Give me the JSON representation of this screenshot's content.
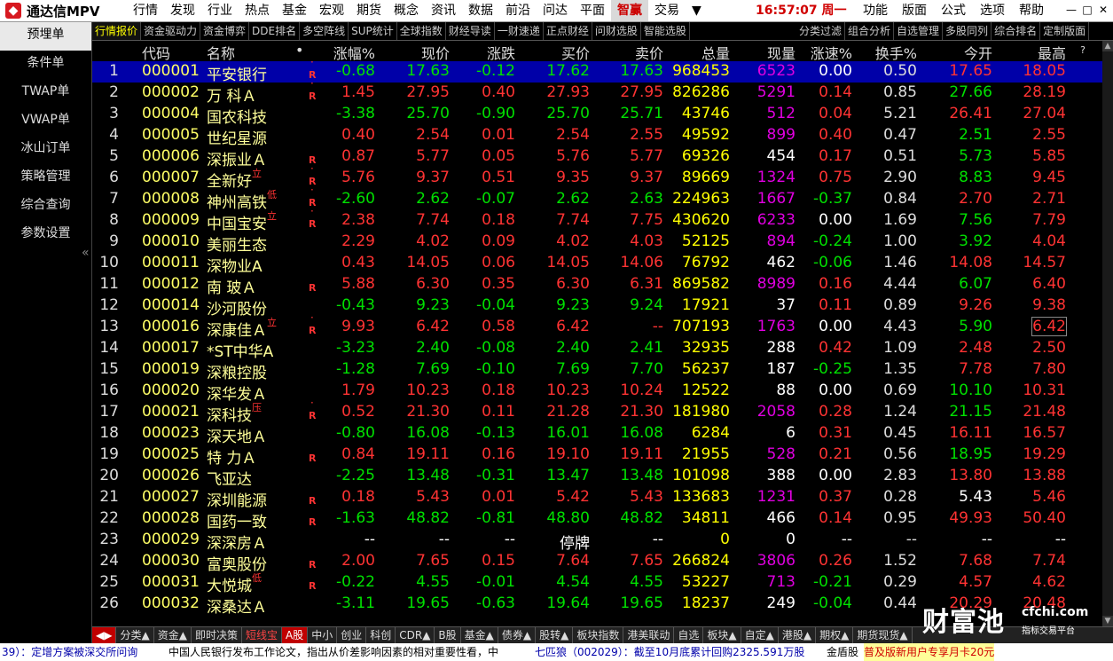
{
  "app": {
    "logo_text": "通达信MPV"
  },
  "menu": [
    "行情",
    "发现",
    "行业",
    "热点",
    "基金",
    "宏观",
    "期货",
    "概念",
    "资讯",
    "数据",
    "前沿",
    "问达",
    "平面",
    "智赢",
    "交易"
  ],
  "menu_dropdown_glyph": "▼",
  "clock": "16:57:07 周一",
  "right_menu": [
    "功能",
    "版面",
    "公式",
    "选项",
    "帮助"
  ],
  "window_controls": [
    "—",
    "□",
    "✕"
  ],
  "sidebar": {
    "items": [
      "预埋单",
      "条件单",
      "TWAP单",
      "VWAP单",
      "冰山订单",
      "策略管理",
      "综合查询",
      "参数设置"
    ],
    "collapse": "«"
  },
  "tabs": [
    "行情报价",
    "资金驱动力",
    "资金博弈",
    "DDE排名",
    "多空阵线",
    "SUP统计",
    "全球指数",
    "财经导读",
    "一财速递",
    "正点财经",
    "问财选股",
    "智能选股"
  ],
  "tabs_right": [
    "分类过滤",
    "组合分析",
    "自选管理",
    "多股同列",
    "综合排名",
    "定制版面"
  ],
  "columns": [
    "代码",
    "名称",
    "•",
    "涨幅%",
    "现价",
    "涨跌",
    "买价",
    "卖价",
    "总量",
    "现量",
    "涨速%",
    "换手%",
    "今开",
    "最高",
    "?"
  ],
  "rows": [
    {
      "idx": "1",
      "code": "000001",
      "name": "平安银行",
      "mark": "",
      "r": "R",
      "dot": "·",
      "chg": "-0.68",
      "price": "17.63",
      "diff": "-0.12",
      "bid": "17.62",
      "ask": "17.63",
      "vol": "968453",
      "cur": "6523",
      "spd": "0.00",
      "turn": "0.50",
      "open": "17.65",
      "high": "18.05"
    },
    {
      "idx": "2",
      "code": "000002",
      "name": "万 科Ａ",
      "mark": "",
      "r": "R",
      "dot": "·",
      "chg": "1.45",
      "price": "27.95",
      "diff": "0.40",
      "bid": "27.93",
      "ask": "27.95",
      "vol": "826286",
      "cur": "5291",
      "spd": "0.14",
      "turn": "0.85",
      "open": "27.66",
      "high": "28.19"
    },
    {
      "idx": "3",
      "code": "000004",
      "name": "国农科技",
      "mark": "",
      "r": "",
      "dot": "",
      "chg": "-3.38",
      "price": "25.70",
      "diff": "-0.90",
      "bid": "25.70",
      "ask": "25.71",
      "vol": "43746",
      "cur": "512",
      "spd": "0.04",
      "turn": "5.21",
      "open": "26.41",
      "high": "27.04"
    },
    {
      "idx": "4",
      "code": "000005",
      "name": "世纪星源",
      "mark": "",
      "r": "",
      "dot": "",
      "chg": "0.40",
      "price": "2.54",
      "diff": "0.01",
      "bid": "2.54",
      "ask": "2.55",
      "vol": "49592",
      "cur": "899",
      "spd": "0.40",
      "turn": "0.47",
      "open": "2.51",
      "high": "2.55"
    },
    {
      "idx": "5",
      "code": "000006",
      "name": "深振业Ａ",
      "mark": "",
      "r": "R",
      "dot": "",
      "chg": "0.87",
      "price": "5.77",
      "diff": "0.05",
      "bid": "5.76",
      "ask": "5.77",
      "vol": "69326",
      "cur": "454",
      "spd": "0.17",
      "turn": "0.51",
      "open": "5.73",
      "high": "5.85"
    },
    {
      "idx": "6",
      "code": "000007",
      "name": "全新好",
      "mark": "立",
      "r": "R",
      "dot": "·",
      "chg": "5.76",
      "price": "9.37",
      "diff": "0.51",
      "bid": "9.35",
      "ask": "9.37",
      "vol": "89669",
      "cur": "1324",
      "spd": "0.75",
      "turn": "2.90",
      "open": "8.83",
      "high": "9.45"
    },
    {
      "idx": "7",
      "code": "000008",
      "name": "神州高铁",
      "mark": "低",
      "r": "R",
      "dot": "·",
      "chg": "-2.60",
      "price": "2.62",
      "diff": "-0.07",
      "bid": "2.62",
      "ask": "2.63",
      "vol": "224963",
      "cur": "1667",
      "spd": "-0.37",
      "turn": "0.84",
      "open": "2.70",
      "high": "2.71"
    },
    {
      "idx": "8",
      "code": "000009",
      "name": "中国宝安",
      "mark": "立",
      "r": "R",
      "dot": "·",
      "chg": "2.38",
      "price": "7.74",
      "diff": "0.18",
      "bid": "7.74",
      "ask": "7.75",
      "vol": "430620",
      "cur": "6233",
      "spd": "0.00",
      "turn": "1.69",
      "open": "7.56",
      "high": "7.79"
    },
    {
      "idx": "9",
      "code": "000010",
      "name": "美丽生态",
      "mark": "",
      "r": "",
      "dot": "",
      "chg": "2.29",
      "price": "4.02",
      "diff": "0.09",
      "bid": "4.02",
      "ask": "4.03",
      "vol": "52125",
      "cur": "894",
      "spd": "-0.24",
      "turn": "1.00",
      "open": "3.92",
      "high": "4.04"
    },
    {
      "idx": "10",
      "code": "000011",
      "name": "深物业A",
      "mark": "",
      "r": "",
      "dot": "",
      "chg": "0.43",
      "price": "14.05",
      "diff": "0.06",
      "bid": "14.05",
      "ask": "14.06",
      "vol": "76792",
      "cur": "462",
      "spd": "-0.06",
      "turn": "1.46",
      "open": "14.08",
      "high": "14.57"
    },
    {
      "idx": "11",
      "code": "000012",
      "name": "南 玻Ａ",
      "mark": "",
      "r": "R",
      "dot": "",
      "chg": "5.88",
      "price": "6.30",
      "diff": "0.35",
      "bid": "6.30",
      "ask": "6.31",
      "vol": "869582",
      "cur": "8989",
      "spd": "0.16",
      "turn": "4.44",
      "open": "6.07",
      "high": "6.40"
    },
    {
      "idx": "12",
      "code": "000014",
      "name": "沙河股份",
      "mark": "",
      "r": "",
      "dot": "",
      "chg": "-0.43",
      "price": "9.23",
      "diff": "-0.04",
      "bid": "9.23",
      "ask": "9.24",
      "vol": "17921",
      "cur": "37",
      "spd": "0.11",
      "turn": "0.89",
      "open": "9.26",
      "high": "9.38"
    },
    {
      "idx": "13",
      "code": "000016",
      "name": "深康佳Ａ",
      "mark": "立",
      "r": "R",
      "dot": "·",
      "chg": "9.93",
      "price": "6.42",
      "diff": "0.58",
      "bid": "6.42",
      "ask": "--",
      "vol": "707193",
      "cur": "1763",
      "spd": "0.00",
      "turn": "4.43",
      "open": "5.90",
      "high": "6.42"
    },
    {
      "idx": "14",
      "code": "000017",
      "name": "*ST中华A",
      "mark": "",
      "r": "",
      "dot": "",
      "chg": "-3.23",
      "price": "2.40",
      "diff": "-0.08",
      "bid": "2.40",
      "ask": "2.41",
      "vol": "32935",
      "cur": "288",
      "spd": "0.42",
      "turn": "1.09",
      "open": "2.48",
      "high": "2.50"
    },
    {
      "idx": "15",
      "code": "000019",
      "name": "深粮控股",
      "mark": "",
      "r": "",
      "dot": "",
      "chg": "-1.28",
      "price": "7.69",
      "diff": "-0.10",
      "bid": "7.69",
      "ask": "7.70",
      "vol": "56237",
      "cur": "187",
      "spd": "-0.25",
      "turn": "1.35",
      "open": "7.78",
      "high": "7.80"
    },
    {
      "idx": "16",
      "code": "000020",
      "name": "深华发Ａ",
      "mark": "",
      "r": "",
      "dot": "",
      "chg": "1.79",
      "price": "10.23",
      "diff": "0.18",
      "bid": "10.23",
      "ask": "10.24",
      "vol": "12522",
      "cur": "88",
      "spd": "0.00",
      "turn": "0.69",
      "open": "10.10",
      "high": "10.31"
    },
    {
      "idx": "17",
      "code": "000021",
      "name": "深科技",
      "mark": "压",
      "r": "R",
      "dot": "·",
      "chg": "0.52",
      "price": "21.30",
      "diff": "0.11",
      "bid": "21.28",
      "ask": "21.30",
      "vol": "181980",
      "cur": "2058",
      "spd": "0.28",
      "turn": "1.24",
      "open": "21.15",
      "high": "21.48"
    },
    {
      "idx": "18",
      "code": "000023",
      "name": "深天地Ａ",
      "mark": "",
      "r": "",
      "dot": "",
      "chg": "-0.80",
      "price": "16.08",
      "diff": "-0.13",
      "bid": "16.01",
      "ask": "16.08",
      "vol": "6284",
      "cur": "6",
      "spd": "0.31",
      "turn": "0.45",
      "open": "16.11",
      "high": "16.57"
    },
    {
      "idx": "19",
      "code": "000025",
      "name": "特 力Ａ",
      "mark": "",
      "r": "R",
      "dot": "",
      "chg": "0.84",
      "price": "19.11",
      "diff": "0.16",
      "bid": "19.10",
      "ask": "19.11",
      "vol": "21955",
      "cur": "528",
      "spd": "0.21",
      "turn": "0.56",
      "open": "18.95",
      "high": "19.29"
    },
    {
      "idx": "20",
      "code": "000026",
      "name": "飞亚达",
      "mark": "",
      "r": "",
      "dot": "",
      "chg": "-2.25",
      "price": "13.48",
      "diff": "-0.31",
      "bid": "13.47",
      "ask": "13.48",
      "vol": "101098",
      "cur": "388",
      "spd": "0.00",
      "turn": "2.83",
      "open": "13.80",
      "high": "13.88"
    },
    {
      "idx": "21",
      "code": "000027",
      "name": "深圳能源",
      "mark": "",
      "r": "R",
      "dot": "",
      "chg": "0.18",
      "price": "5.43",
      "diff": "0.01",
      "bid": "5.42",
      "ask": "5.43",
      "vol": "133683",
      "cur": "1231",
      "spd": "0.37",
      "turn": "0.28",
      "open": "5.43",
      "high": "5.46"
    },
    {
      "idx": "22",
      "code": "000028",
      "name": "国药一致",
      "mark": "",
      "r": "R",
      "dot": "",
      "chg": "-1.63",
      "price": "48.82",
      "diff": "-0.81",
      "bid": "48.80",
      "ask": "48.82",
      "vol": "34811",
      "cur": "466",
      "spd": "0.14",
      "turn": "0.95",
      "open": "49.93",
      "high": "50.40"
    },
    {
      "idx": "23",
      "code": "000029",
      "name": "深深房Ａ",
      "mark": "",
      "r": "",
      "dot": "",
      "chg": "--",
      "price": "--",
      "diff": "--",
      "bid": "停牌",
      "ask": "--",
      "vol": "0",
      "cur": "0",
      "spd": "--",
      "turn": "--",
      "open": "--",
      "high": "--"
    },
    {
      "idx": "24",
      "code": "000030",
      "name": "富奥股份",
      "mark": "",
      "r": "R",
      "dot": "",
      "chg": "2.00",
      "price": "7.65",
      "diff": "0.15",
      "bid": "7.64",
      "ask": "7.65",
      "vol": "266824",
      "cur": "3806",
      "spd": "0.26",
      "turn": "1.52",
      "open": "7.68",
      "high": "7.74"
    },
    {
      "idx": "25",
      "code": "000031",
      "name": "大悦城",
      "mark": "低",
      "r": "R",
      "dot": "",
      "chg": "-0.22",
      "price": "4.55",
      "diff": "-0.01",
      "bid": "4.54",
      "ask": "4.55",
      "vol": "53227",
      "cur": "713",
      "spd": "-0.21",
      "turn": "0.29",
      "open": "4.57",
      "high": "4.62"
    },
    {
      "idx": "26",
      "code": "000032",
      "name": "深桑达Ａ",
      "mark": "",
      "r": "",
      "dot": "",
      "chg": "-3.11",
      "price": "19.65",
      "diff": "-0.63",
      "bid": "19.64",
      "ask": "19.65",
      "vol": "18237",
      "cur": "249",
      "spd": "-0.04",
      "turn": "0.44",
      "open": "20.29",
      "high": "20.48"
    }
  ],
  "bottom_tabs": [
    "◀▶",
    "分类▲",
    "资金▲",
    "即时决策",
    "短线宝",
    "A股",
    "中小",
    "创业",
    "科创",
    "CDR▲",
    "B股",
    "基金▲",
    "债券▲",
    "股转▲",
    "板块指数",
    "港美联动",
    "自选",
    "板块▲",
    "自定▲",
    "港股▲",
    "期权▲",
    "期货现货▲"
  ],
  "ticker": {
    "t1": "39）：定增方案被深交所问询",
    "t2": "中国人民银行发布工作论文，指出从价差影响因素的相对重要性看，中",
    "t3": "七匹狼（002029）：截至10月底累计回购2325.591万股",
    "t4": "金盾股",
    "promo": "普及版新用户专享月卡20元"
  },
  "watermark": {
    "main": "财富池",
    "url": "cfchi.com",
    "sub": "指标交易平台"
  }
}
